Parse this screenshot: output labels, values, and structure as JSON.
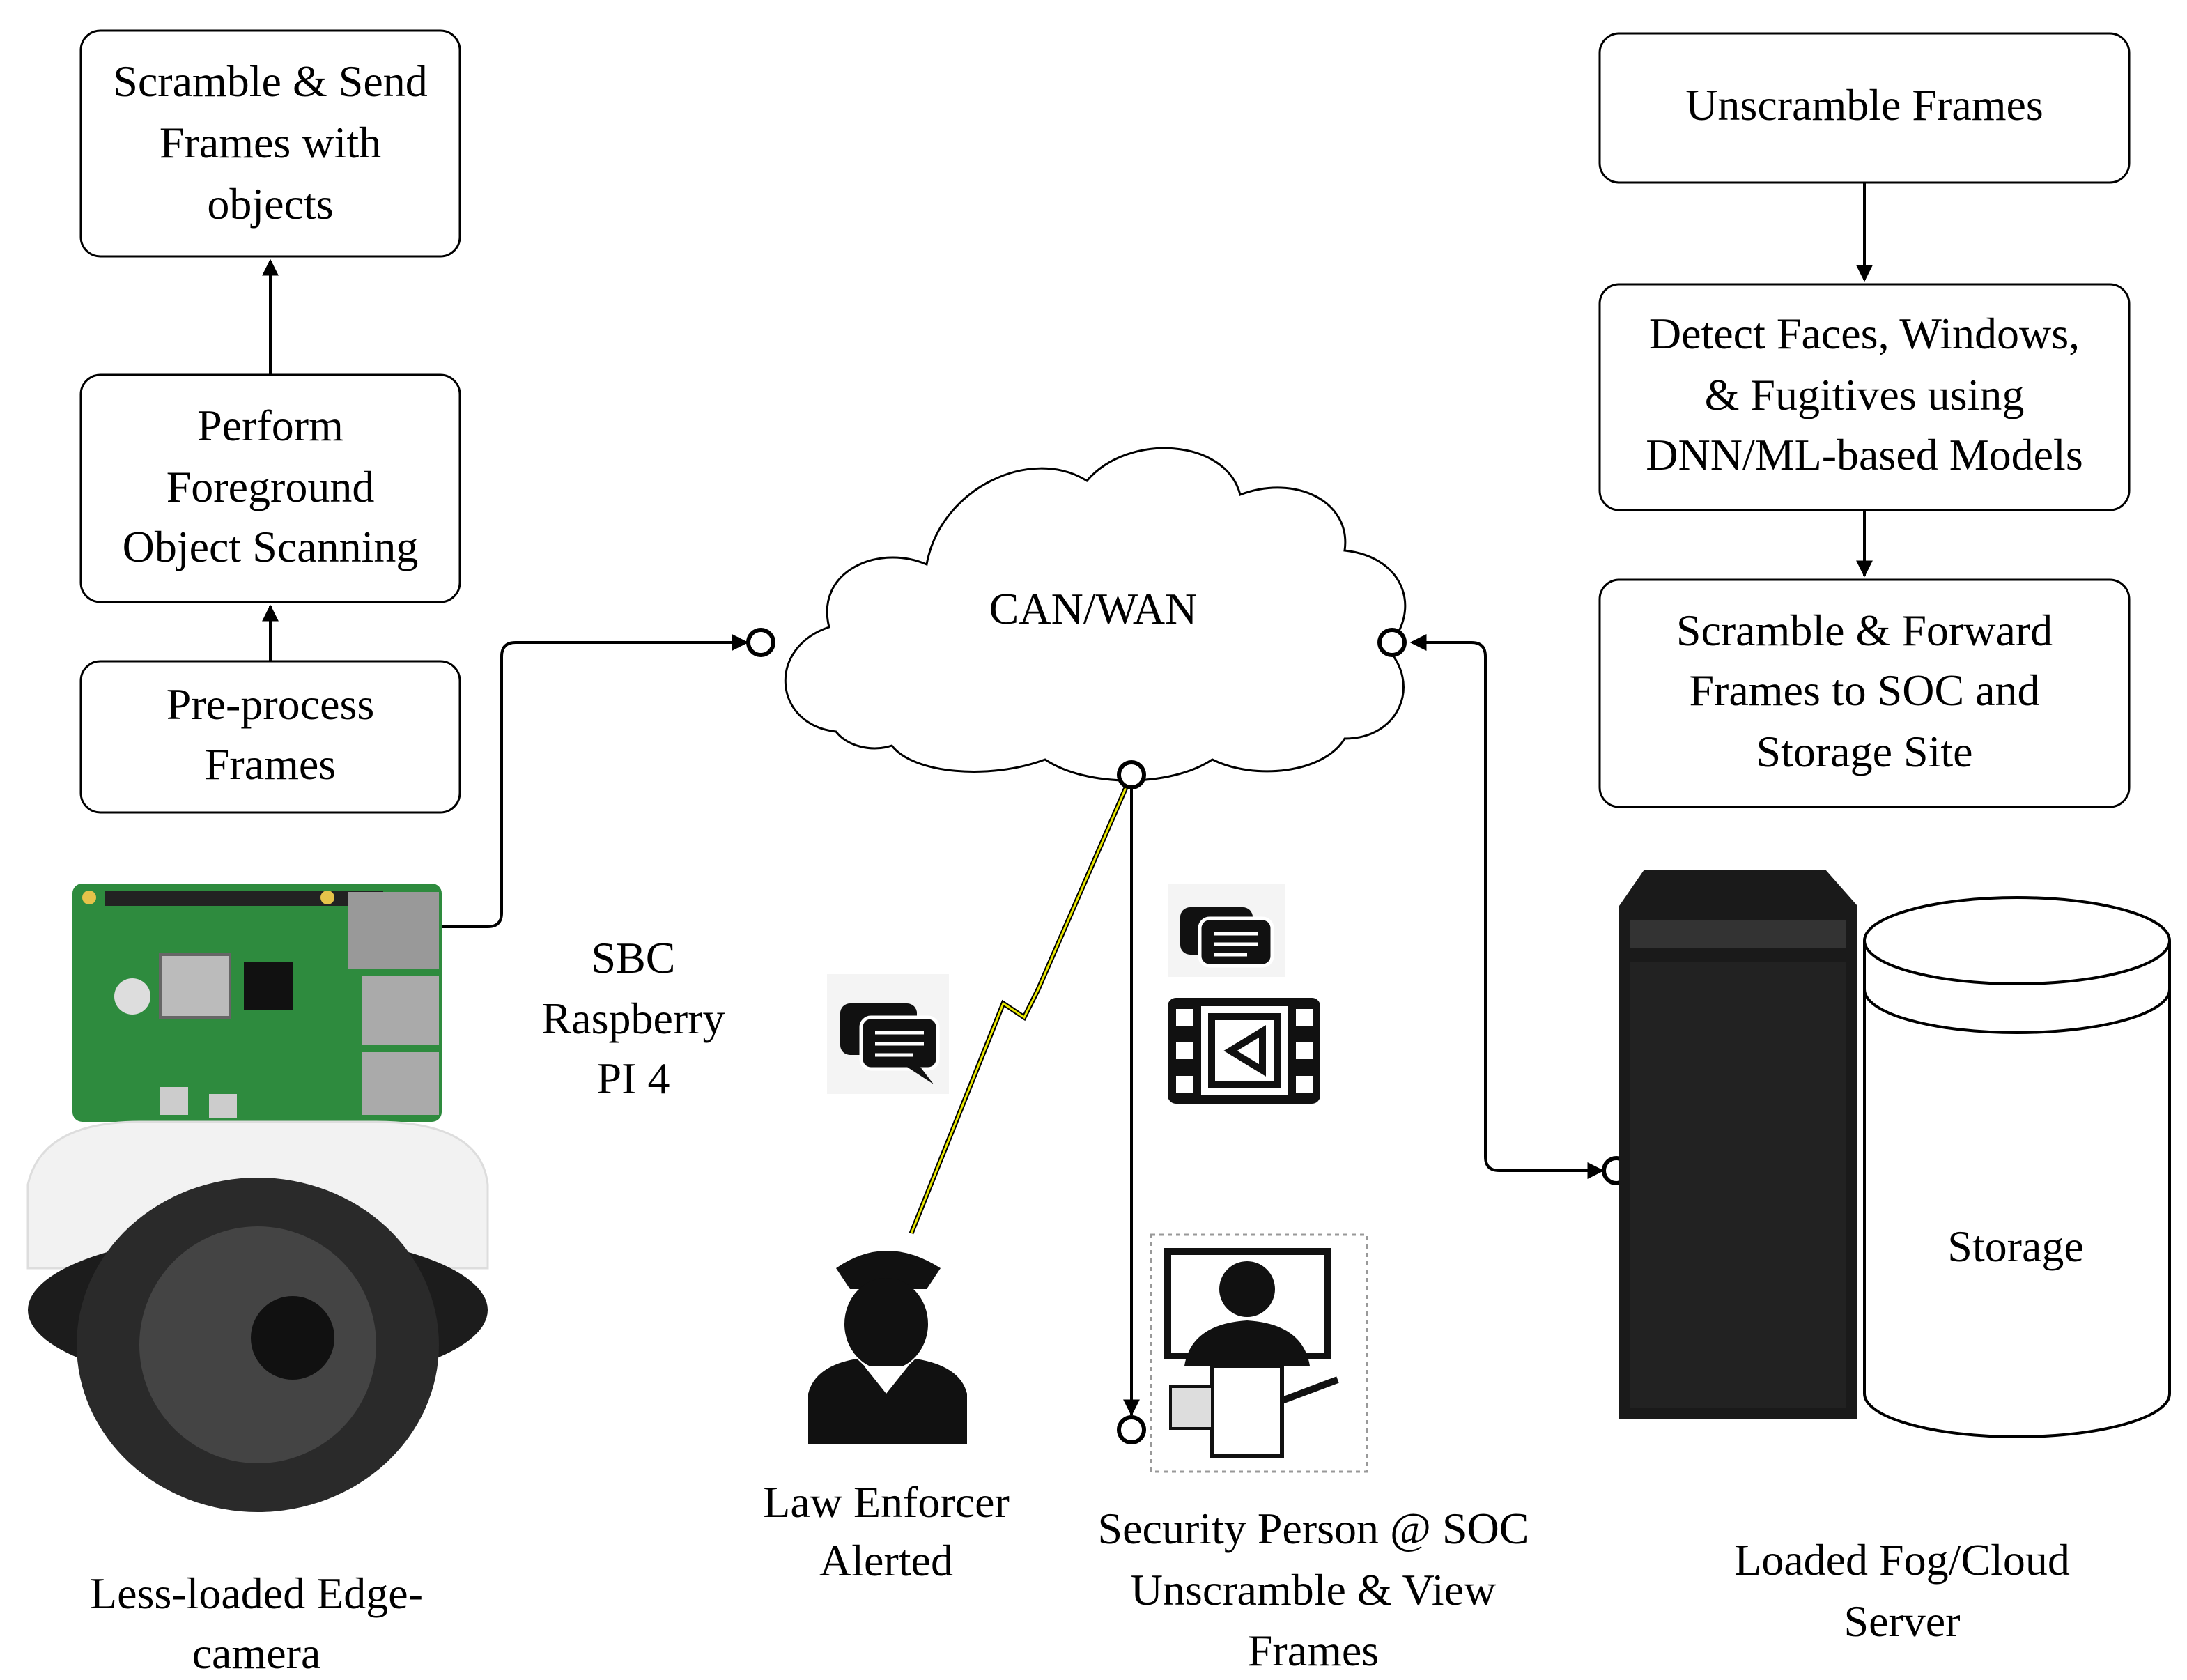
{
  "left_boxes": {
    "scramble_send": [
      "Scramble & Send",
      "Frames with",
      "objects"
    ],
    "perform": [
      "Perform",
      "Foreground",
      "Object Scanning"
    ],
    "preprocess": [
      "Pre-process",
      "Frames"
    ]
  },
  "right_boxes": {
    "unscramble": [
      "Unscramble Frames"
    ],
    "detect": [
      "Detect Faces, Windows,",
      "& Fugitives  using",
      "DNN/ML-based Models"
    ],
    "scramble_forward": [
      "Scramble & Forward",
      "Frames  to SOC and",
      "Storage Site"
    ]
  },
  "network": {
    "label": "CAN/WAN"
  },
  "labels": {
    "sbc": [
      "SBC",
      "Raspberry",
      "PI 4"
    ],
    "edge_camera": [
      "Less-loaded Edge-",
      "camera"
    ],
    "law_enforcer": [
      "Law Enforcer",
      "Alerted"
    ],
    "security_person": [
      "Security Person @ SOC",
      "Unscramble & View",
      "Frames"
    ],
    "server": [
      "Loaded Fog/Cloud",
      "Server"
    ],
    "storage": "Storage"
  },
  "icons": [
    "raspberry-pi-board",
    "dome-camera",
    "chat-icon",
    "video-film-icon",
    "police-officer-icon",
    "security-operator-icon",
    "server-tower",
    "storage-cylinder",
    "lightning-wireless-link"
  ],
  "colors": {
    "board_green": "#2e8b3e",
    "lightning": "#e8e800"
  }
}
